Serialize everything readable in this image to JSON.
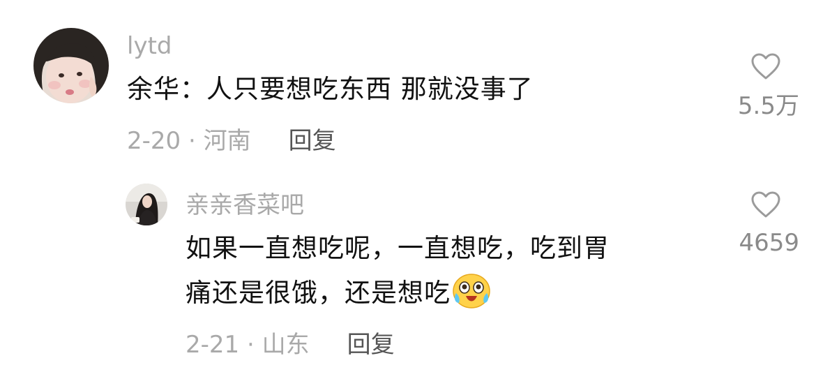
{
  "comments": [
    {
      "username": "lytd",
      "text": "余华：人只要想吃东西 那就没事了",
      "date_location": "2-20 · 河南",
      "reply_label": "回复",
      "like_count": "5.5万",
      "avatar_icon": "user-avatar"
    },
    {
      "username": "亲亲香菜吧",
      "text_line1": "如果一直想吃呢，一直想吃，吃到胃",
      "text_line2": "痛还是很饿，还是想吃",
      "emoji": "crying-laughing-emoji",
      "date_location": "2-21 · 山东",
      "reply_label": "回复",
      "like_count": "4659",
      "avatar_icon": "user-avatar"
    }
  ],
  "colors": {
    "muted_text": "#a9a9a9",
    "body_text": "#111111",
    "reply_text": "#555555"
  }
}
